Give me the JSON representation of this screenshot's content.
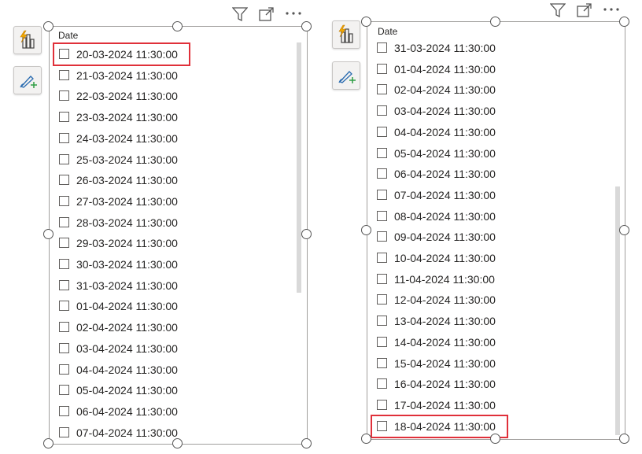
{
  "left_slicer": {
    "header": "Date",
    "items": [
      "20-03-2024 11:30:00",
      "21-03-2024 11:30:00",
      "22-03-2024 11:30:00",
      "23-03-2024 11:30:00",
      "24-03-2024 11:30:00",
      "25-03-2024 11:30:00",
      "26-03-2024 11:30:00",
      "27-03-2024 11:30:00",
      "28-03-2024 11:30:00",
      "29-03-2024 11:30:00",
      "30-03-2024 11:30:00",
      "31-03-2024 11:30:00",
      "01-04-2024 11:30:00",
      "02-04-2024 11:30:00",
      "03-04-2024 11:30:00",
      "04-04-2024 11:30:00",
      "05-04-2024 11:30:00",
      "06-04-2024 11:30:00",
      "07-04-2024 11:30:00"
    ],
    "highlighted_index": 0
  },
  "right_slicer": {
    "header": "Date",
    "items": [
      "31-03-2024 11:30:00",
      "01-04-2024 11:30:00",
      "02-04-2024 11:30:00",
      "03-04-2024 11:30:00",
      "04-04-2024 11:30:00",
      "05-04-2024 11:30:00",
      "06-04-2024 11:30:00",
      "07-04-2024 11:30:00",
      "08-04-2024 11:30:00",
      "09-04-2024 11:30:00",
      "10-04-2024 11:30:00",
      "11-04-2024 11:30:00",
      "12-04-2024 11:30:00",
      "13-04-2024 11:30:00",
      "14-04-2024 11:30:00",
      "15-04-2024 11:30:00",
      "16-04-2024 11:30:00",
      "17-04-2024 11:30:00",
      "18-04-2024 11:30:00"
    ],
    "highlighted_index": 18
  },
  "icons": {
    "visual_build": "build-visual-icon",
    "format": "format-visual-icon",
    "filter": "filter-icon",
    "focus": "focus-mode-icon",
    "more": "more-options-icon"
  },
  "colors": {
    "highlight": "#e0303a",
    "accent_orange": "#f2a900",
    "accent_green": "#2e9e44",
    "brush_blue": "#2b6cb0"
  }
}
